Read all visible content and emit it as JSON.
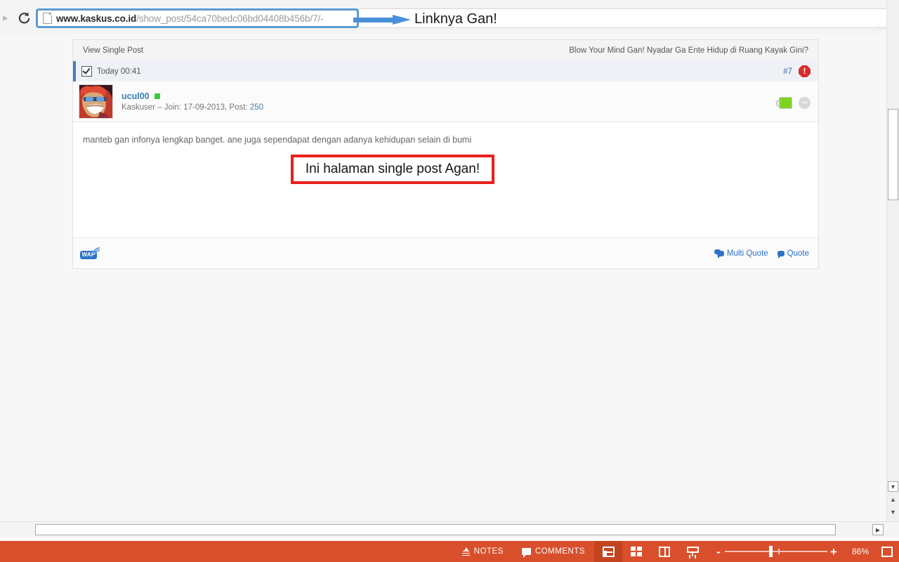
{
  "browser": {
    "forward_icon": "forward-arrow-icon",
    "reload_icon": "reload-icon",
    "page_icon": "page-icon",
    "url_host": "www.kaskus.co.id",
    "url_path": "/show_post/54ca70bedc06bd04408b456b/7/-",
    "star_icon": "star-icon"
  },
  "annotations": {
    "arrow_label": "Linknya Gan!",
    "arrow_color": "#4a90d9",
    "red_box_text": "Ini halaman single post Agan!",
    "red_box_color": "#e8201a",
    "url_highlight_color": "#5b9bd5"
  },
  "kaskus": {
    "topbar": {
      "left_label": "View Single Post",
      "right_label": "Blow Your Mind Gan! Nyadar Ga Ente Hidup di Ruang Kayak Gini?"
    },
    "post": {
      "checkbox_icon": "checkbox-checked-icon",
      "time": "Today 00:41",
      "post_number": "#7",
      "report_icon": "report-icon",
      "user": {
        "avatar_icon": "user-avatar",
        "username": "ucul00",
        "online_status_icon": "online-dot-icon",
        "meta_prefix": "Kaskuser – Join: 17-09-2013, Post: ",
        "post_count": "250",
        "cendol_icon": "cendol-mug-icon",
        "bata_icon": "gray-circle-icon"
      },
      "body_text": "manteb gan infonya lengkap banget. ane juga sependapat dengan adanya kehidupan selain di bumi",
      "footer": {
        "wap_icon": "wap-icon",
        "wap_label": "WAP",
        "multi_quote_label": "Multi Quote",
        "quote_label": "Quote"
      }
    }
  },
  "scrollbars": {
    "v_down_arrow_icon": "chevron-down-icon",
    "v_prev_slide_icon": "previous-slide-icon",
    "v_next_slide_icon": "next-slide-icon",
    "h_right_arrow_icon": "chevron-right-icon"
  },
  "status_bar": {
    "background": "#d94f2c",
    "notes_label": "NOTES",
    "notes_icon": "notes-icon",
    "comments_label": "COMMENTS",
    "comments_icon": "comments-icon",
    "views": [
      {
        "name": "normal-view",
        "icon": "normal-view-icon",
        "active": true
      },
      {
        "name": "slide-sorter-view",
        "icon": "slide-sorter-icon",
        "active": false
      },
      {
        "name": "reading-view",
        "icon": "reading-view-icon",
        "active": false
      },
      {
        "name": "slide-show-view",
        "icon": "slide-show-icon",
        "active": false
      }
    ],
    "zoom_out_label": "-",
    "zoom_in_label": "+",
    "zoom_value": "86%",
    "fit_icon": "fit-to-window-icon"
  }
}
